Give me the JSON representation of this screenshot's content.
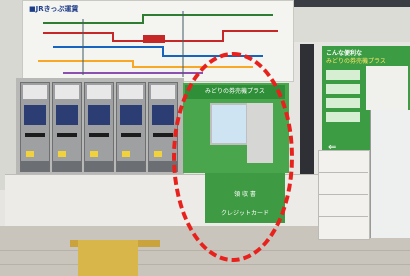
{
  "route_map": {
    "title": "■JRきっぷ運賃"
  },
  "machine": {
    "header": "みどりの券売機プラス",
    "panel_label_1": "領 収 書",
    "panel_label_2": "クレジットカード"
  },
  "signboard": {
    "title": "こんな便利な",
    "subtitle": "みどりの券売機プラス"
  },
  "colors": {
    "highlight": "#e8211c",
    "machine_green": "#49a64c",
    "route_map_blue": "#1f3e8a"
  }
}
